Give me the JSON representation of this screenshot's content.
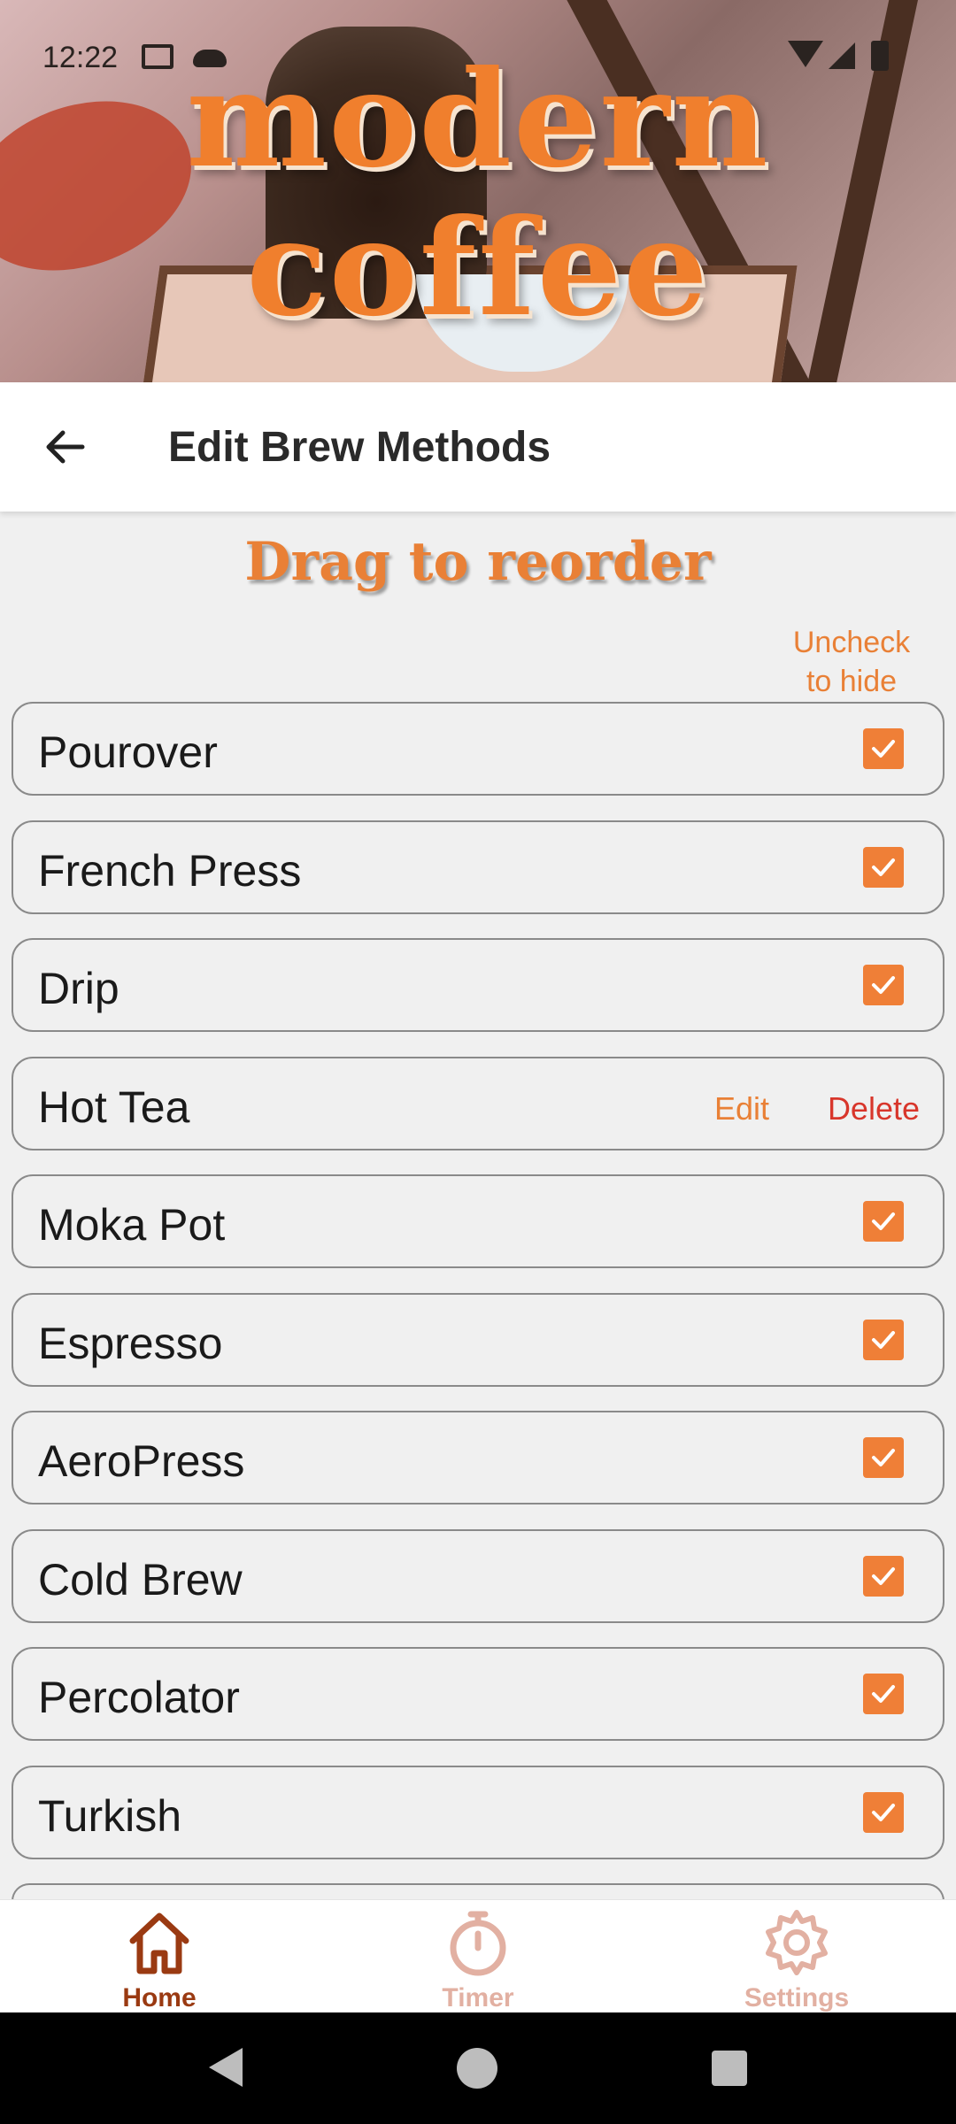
{
  "status_bar": {
    "time": "12:22"
  },
  "hero": {
    "brand_line1": "modern",
    "brand_line2": "coffee"
  },
  "app_bar": {
    "title": "Edit Brew Methods"
  },
  "subtitle": "Drag to reorder",
  "hint": {
    "line1": "Uncheck",
    "line2": "to hide"
  },
  "methods": [
    {
      "name": "Pourover",
      "checked": true
    },
    {
      "name": "French Press",
      "checked": true
    },
    {
      "name": "Drip",
      "checked": true
    },
    {
      "name": "Hot Tea",
      "edit_label": "Edit",
      "delete_label": "Delete"
    },
    {
      "name": "Moka Pot",
      "checked": true
    },
    {
      "name": "Espresso",
      "checked": true
    },
    {
      "name": "AeroPress",
      "checked": true
    },
    {
      "name": "Cold Brew",
      "checked": true
    },
    {
      "name": "Percolator",
      "checked": true
    },
    {
      "name": "Turkish",
      "checked": true
    }
  ],
  "bottom_nav": [
    {
      "label": "Home",
      "active": true
    },
    {
      "label": "Timer",
      "active": false
    },
    {
      "label": "Settings",
      "active": false
    }
  ],
  "colors": {
    "accent": "#ef7f37",
    "delete": "#d8362b",
    "nav_active": "#9a3a12",
    "nav_inactive": "#e2b0a2"
  }
}
